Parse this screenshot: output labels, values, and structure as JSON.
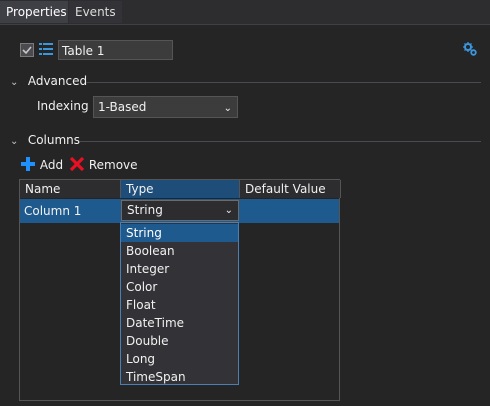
{
  "tabs": [
    {
      "label": "Properties",
      "active": true
    },
    {
      "label": "Events",
      "active": false
    }
  ],
  "header": {
    "name_value": "Table 1",
    "enabled_checked": true
  },
  "advanced": {
    "title": "Advanced",
    "indexing_label": "Indexing",
    "indexing_value": "1-Based"
  },
  "columns": {
    "title": "Columns",
    "add_label": "Add",
    "remove_label": "Remove",
    "headers": [
      "Name",
      "Type",
      "Default Value"
    ],
    "rows": [
      {
        "name": "Column 1",
        "type": "String",
        "default": ""
      }
    ],
    "type_options": [
      "String",
      "Boolean",
      "Integer",
      "Color",
      "Float",
      "DateTime",
      "Double",
      "Long",
      "TimeSpan"
    ],
    "highlighted_option": "String"
  },
  "colors": {
    "background": "#252526",
    "accent": "#1e5a8e",
    "add_icon": "#1e90ff",
    "remove_icon": "#e81123"
  },
  "icons": {
    "list": "list-icon",
    "settings": "gear-icon",
    "add": "plus-icon",
    "remove": "x-icon"
  }
}
